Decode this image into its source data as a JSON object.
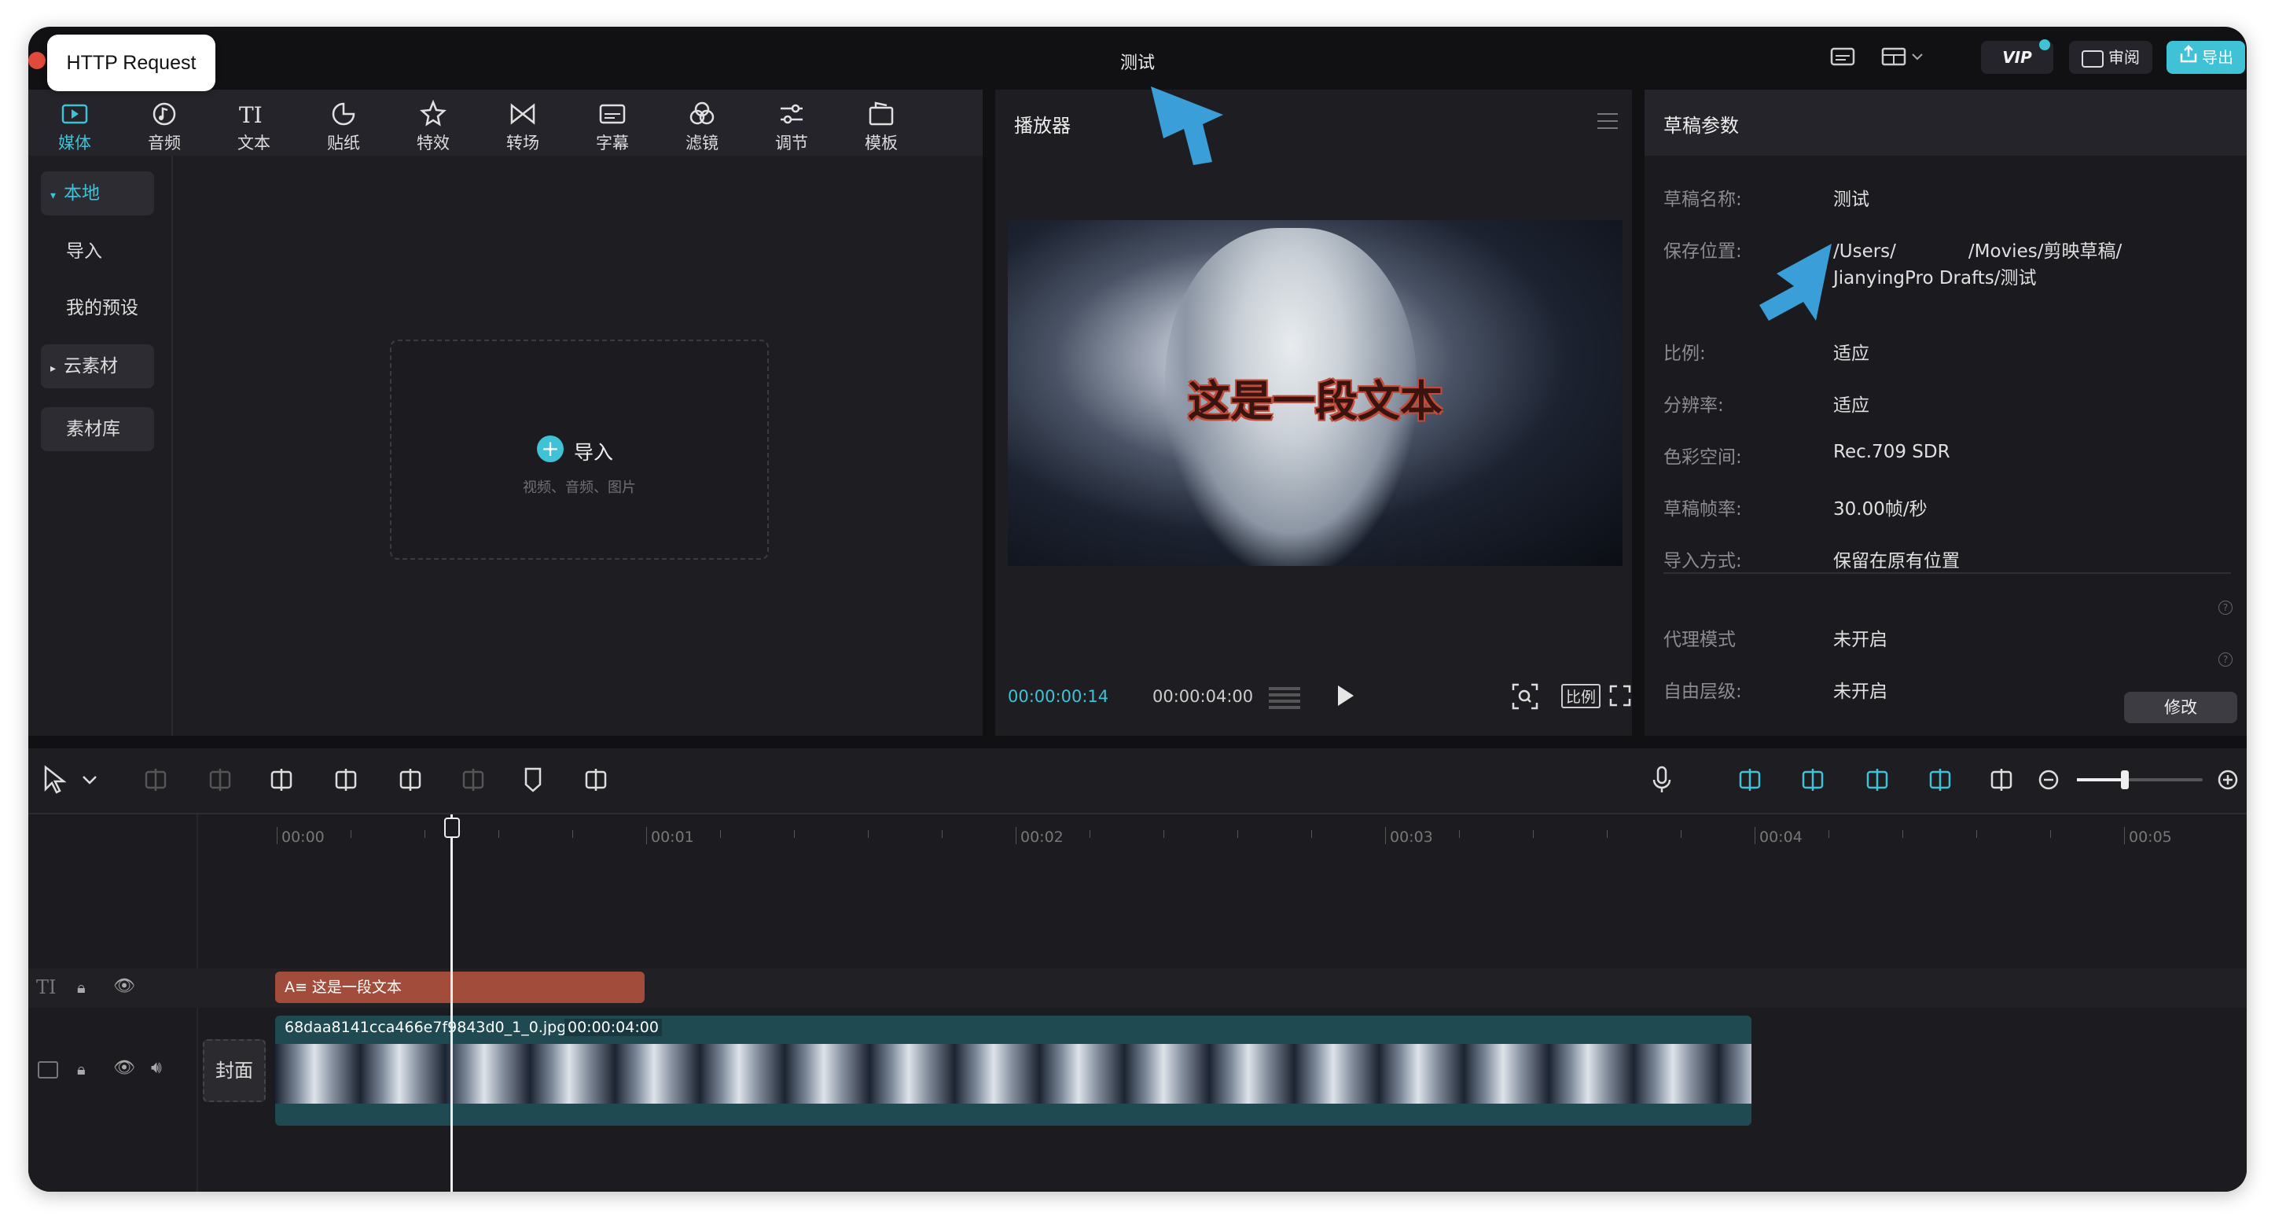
{
  "overlay": {
    "tag_label": "HTTP Request"
  },
  "app": {
    "title": "测试"
  },
  "header": {
    "vip_label": "VIP",
    "review_label": "审阅",
    "export_label": "导出"
  },
  "toolbar": [
    {
      "label": "媒体",
      "icon": "media-icon",
      "active": true
    },
    {
      "label": "音频",
      "icon": "audio-icon"
    },
    {
      "label": "文本",
      "icon": "text-icon"
    },
    {
      "label": "贴纸",
      "icon": "sticker-icon"
    },
    {
      "label": "特效",
      "icon": "effects-icon"
    },
    {
      "label": "转场",
      "icon": "transition-icon"
    },
    {
      "label": "字幕",
      "icon": "subtitle-icon"
    },
    {
      "label": "滤镜",
      "icon": "filter-icon"
    },
    {
      "label": "调节",
      "icon": "adjust-icon"
    },
    {
      "label": "模板",
      "icon": "template-icon"
    }
  ],
  "sidebar": {
    "local": "本地",
    "import": "导入",
    "presets": "我的预设",
    "cloud": "云素材",
    "library": "素材库"
  },
  "media": {
    "import_label": "导入",
    "import_hint": "视频、音频、图片"
  },
  "player": {
    "title": "播放器",
    "overlay_text": "这是一段文本",
    "current_time": "00:00:00:14",
    "total_time": "00:00:04:00",
    "ratio_label": "比例"
  },
  "draft": {
    "title": "草稿参数",
    "props": [
      {
        "label": "草稿名称:",
        "value": "测试"
      },
      {
        "label": "保存位置:",
        "value": "/Users/    /Movies/剪映草稿/",
        "value2": "JianyingPro Drafts/测试"
      },
      {
        "label": "比例:",
        "value": "适应"
      },
      {
        "label": "分辨率:",
        "value": "适应"
      },
      {
        "label": "色彩空间:",
        "value": "Rec.709 SDR"
      },
      {
        "label": "草稿帧率:",
        "value": "30.00帧/秒"
      },
      {
        "label": "导入方式:",
        "value": "保留在原有位置"
      },
      {
        "label": "代理模式",
        "value": "未开启"
      },
      {
        "label": "自由层级:",
        "value": "未开启"
      }
    ],
    "modify_label": "修改"
  },
  "timeline": {
    "ruler": [
      "00:00",
      "00:01",
      "00:02",
      "00:03",
      "00:04",
      "00:05"
    ],
    "text_clip": "这是一段文本",
    "text_clip_prefix": "A≡",
    "video_clip_name": "68daa8141cca466e7f9843d0_1_0.jpg",
    "video_clip_duration": "00:00:04:00",
    "cover_label": "封面",
    "playhead_seconds": 0.47
  },
  "colors": {
    "accent": "#3fc2d6",
    "text_clip": "#a24d3c",
    "video_clip": "#1f4a52",
    "arrow": "#3a9fd8"
  }
}
